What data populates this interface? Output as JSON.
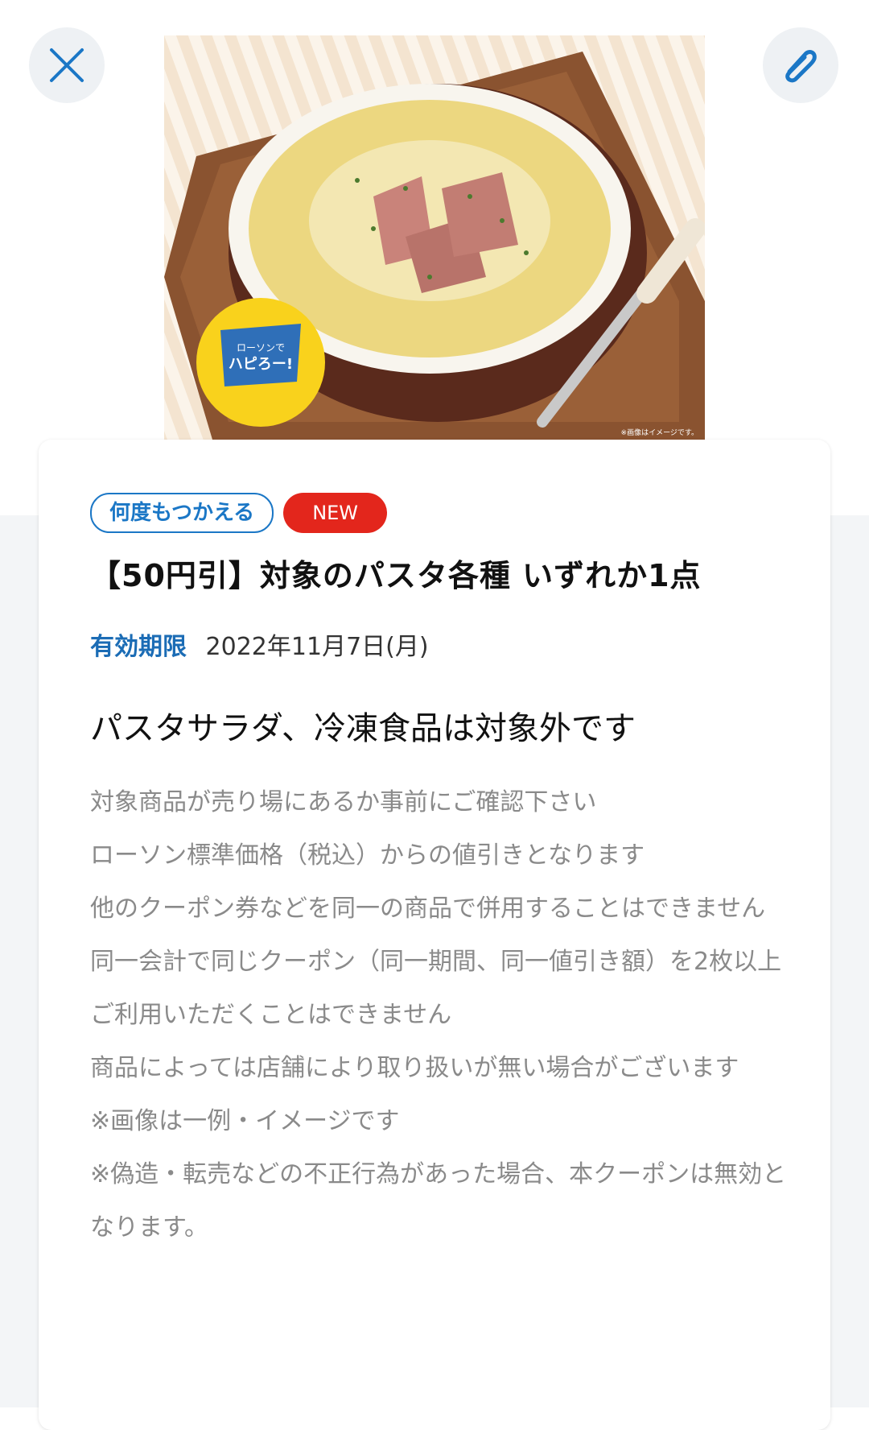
{
  "header": {
    "close_icon": "close-icon",
    "clip_icon": "paperclip-icon"
  },
  "hero": {
    "logo_line1": "ローソンで",
    "logo_line2": "ハピろー!",
    "caption": "※画像はイメージです。"
  },
  "coupon": {
    "badge_reuse": "何度もつかえる",
    "badge_new": "NEW",
    "title": "【50円引】対象のパスタ各種 いずれか1点",
    "validity_label": "有効期限",
    "validity_date": "2022年11月7日(月)",
    "subtitle": "パスタサラダ、冷凍食品は対象外です",
    "notes": [
      "対象商品が売り場にあるか事前にご確認下さい",
      "ローソン標準価格（税込）からの値引きとなります",
      "他のクーポン券などを同一の商品で併用することはできません",
      "同一会計で同じクーポン（同一期間、同一値引き額）を2枚以上ご利用いただくことはできません",
      "商品によっては店舗により取り扱いが無い場合がございます",
      "※画像は一例・イメージです",
      "※偽造・転売などの不正行為があった場合、本クーポンは無効となります。"
    ]
  },
  "colors": {
    "accent_blue": "#1b77c6",
    "new_red": "#e3261c"
  }
}
